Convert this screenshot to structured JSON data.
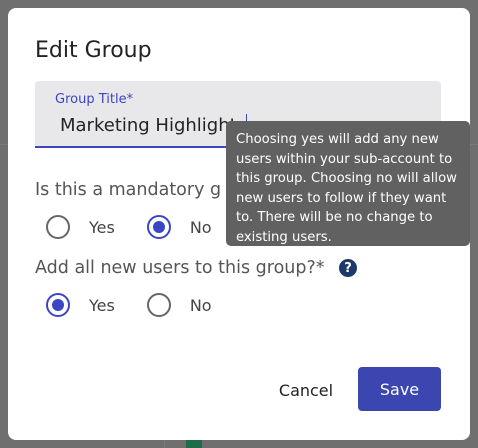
{
  "dialog": {
    "title": "Edit Group",
    "group_title_field": {
      "label": "Group Title*",
      "value": "Marketing Highlight"
    },
    "mandatory_question": {
      "text": "Is this a mandatory g",
      "options": [
        {
          "label": "Yes",
          "checked": false
        },
        {
          "label": "No",
          "checked": true
        }
      ]
    },
    "add_new_users_question": {
      "text": "Add all new users to this group?*",
      "options": [
        {
          "label": "Yes",
          "checked": true
        },
        {
          "label": "No",
          "checked": false
        }
      ]
    },
    "tooltip": "Choosing yes will add any new users within your sub-account to this group. Choosing no will allow new users to follow if they want to. There will be no change to existing users.",
    "help_icon": "question-circle-icon",
    "buttons": {
      "cancel": "Cancel",
      "save": "Save"
    }
  },
  "colors": {
    "accent": "#3b46c4",
    "save_button": "#3b46b0",
    "tooltip_bg": "#616161",
    "overlay": "#6f6f6f"
  }
}
